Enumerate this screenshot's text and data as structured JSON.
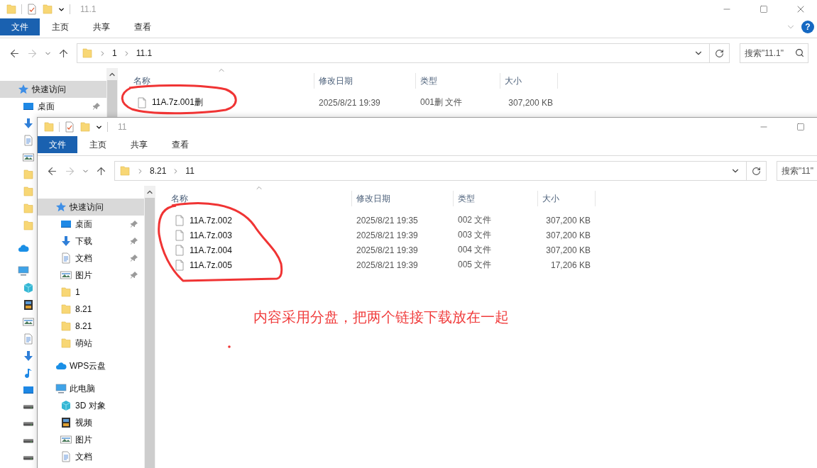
{
  "windows": [
    {
      "title": "11.1",
      "tabs": [
        {
          "label": "文件",
          "kind": "file"
        },
        {
          "label": "主页",
          "kind": "tab"
        },
        {
          "label": "共享",
          "kind": "tab"
        },
        {
          "label": "查看",
          "kind": "tab"
        }
      ],
      "help": "?",
      "nav": [
        {
          "kind": "back",
          "disabled": false
        },
        {
          "kind": "forward",
          "disabled": true
        },
        {
          "kind": "recent",
          "disabled": false
        },
        {
          "kind": "up",
          "disabled": false
        }
      ],
      "path": [
        "1",
        "11.1"
      ],
      "search": {
        "placeholder": "搜索\"11.1\""
      },
      "columns": [
        "名称",
        "修改日期",
        "类型",
        "大小"
      ],
      "rows": [
        {
          "name": "11A.7z.001删",
          "date": "2025/8/21 19:39",
          "type": "001删 文件",
          "size": "307,200 KB"
        }
      ],
      "sidebar": [
        {
          "label": "快速访问",
          "kind": "star",
          "selected": true,
          "children": [
            {
              "label": "桌面",
              "kind": "desktop",
              "selected": false,
              "pinned": true
            },
            {
              "kind": "downloads",
              "selected": false
            },
            {
              "kind": "documents",
              "selected": false
            },
            {
              "kind": "pictures",
              "selected": false
            },
            {
              "kind": "folder",
              "selected": false
            },
            {
              "kind": "folder",
              "selected": false
            },
            {
              "kind": "folder",
              "selected": false
            },
            {
              "kind": "folder",
              "selected": false
            }
          ]
        },
        {
          "kind": "cloud",
          "selected": false
        },
        {
          "kind": "pc",
          "selected": false,
          "children": [
            {
              "kind": "cube",
              "selected": false
            },
            {
              "kind": "film",
              "selected": false
            },
            {
              "kind": "pictures",
              "selected": false
            },
            {
              "kind": "documents",
              "selected": false
            },
            {
              "kind": "downloads",
              "selected": false
            },
            {
              "kind": "music",
              "selected": false
            },
            {
              "kind": "desktop",
              "selected": false
            },
            {
              "kind": "drive",
              "selected": false
            },
            {
              "kind": "drive",
              "selected": false
            },
            {
              "kind": "drive",
              "selected": false
            },
            {
              "kind": "drive",
              "selected": false
            }
          ]
        }
      ]
    },
    {
      "title": "11",
      "tabs": [
        {
          "label": "文件",
          "kind": "file"
        },
        {
          "label": "主页",
          "kind": "tab"
        },
        {
          "label": "共享",
          "kind": "tab"
        },
        {
          "label": "查看",
          "kind": "tab"
        }
      ],
      "nav": [
        {
          "kind": "back",
          "disabled": false
        },
        {
          "kind": "forward",
          "disabled": true
        },
        {
          "kind": "recent",
          "disabled": false
        },
        {
          "kind": "up",
          "disabled": false
        }
      ],
      "path": [
        "8.21",
        "11"
      ],
      "search": {
        "placeholder": "搜索\"11\""
      },
      "columns": [
        "名称",
        "修改日期",
        "类型",
        "大小"
      ],
      "rows": [
        {
          "name": "11A.7z.002",
          "date": "2025/8/21 19:35",
          "type": "002 文件",
          "size": "307,200 KB"
        },
        {
          "name": "11A.7z.003",
          "date": "2025/8/21 19:39",
          "type": "003 文件",
          "size": "307,200 KB"
        },
        {
          "name": "11A.7z.004",
          "date": "2025/8/21 19:39",
          "type": "004 文件",
          "size": "307,200 KB"
        },
        {
          "name": "11A.7z.005",
          "date": "2025/8/21 19:39",
          "type": "005 文件",
          "size": "17,206 KB"
        }
      ],
      "sidebar": [
        {
          "label": "快速访问",
          "kind": "star",
          "selected": true,
          "children": [
            {
              "label": "桌面",
              "kind": "desktop",
              "selected": false,
              "pinned": true
            },
            {
              "label": "下载",
              "kind": "downloads",
              "selected": false,
              "pinned": true
            },
            {
              "label": "文档",
              "kind": "documents",
              "selected": false,
              "pinned": true
            },
            {
              "label": "图片",
              "kind": "pictures",
              "selected": false,
              "pinned": true
            },
            {
              "label": "1",
              "kind": "folder",
              "selected": false,
              "pinned": false
            },
            {
              "label": "8.21",
              "kind": "folder",
              "selected": false,
              "pinned": false
            },
            {
              "label": "8.21",
              "kind": "folder",
              "selected": false,
              "pinned": false
            },
            {
              "label": "萌站",
              "kind": "folder",
              "selected": false,
              "pinned": false
            }
          ]
        },
        {
          "label": "WPS云盘",
          "kind": "cloud",
          "selected": false
        },
        {
          "label": "此电脑",
          "kind": "pc",
          "selected": false,
          "children": [
            {
              "label": "3D 对象",
              "kind": "cube",
              "selected": false
            },
            {
              "label": "视频",
              "kind": "film",
              "selected": false
            },
            {
              "label": "图片",
              "kind": "pictures",
              "selected": false
            },
            {
              "label": "文档",
              "kind": "documents",
              "selected": false
            }
          ]
        }
      ]
    }
  ],
  "annotation": {
    "text": "内容采用分盘，把两个链接下载放在一起"
  }
}
